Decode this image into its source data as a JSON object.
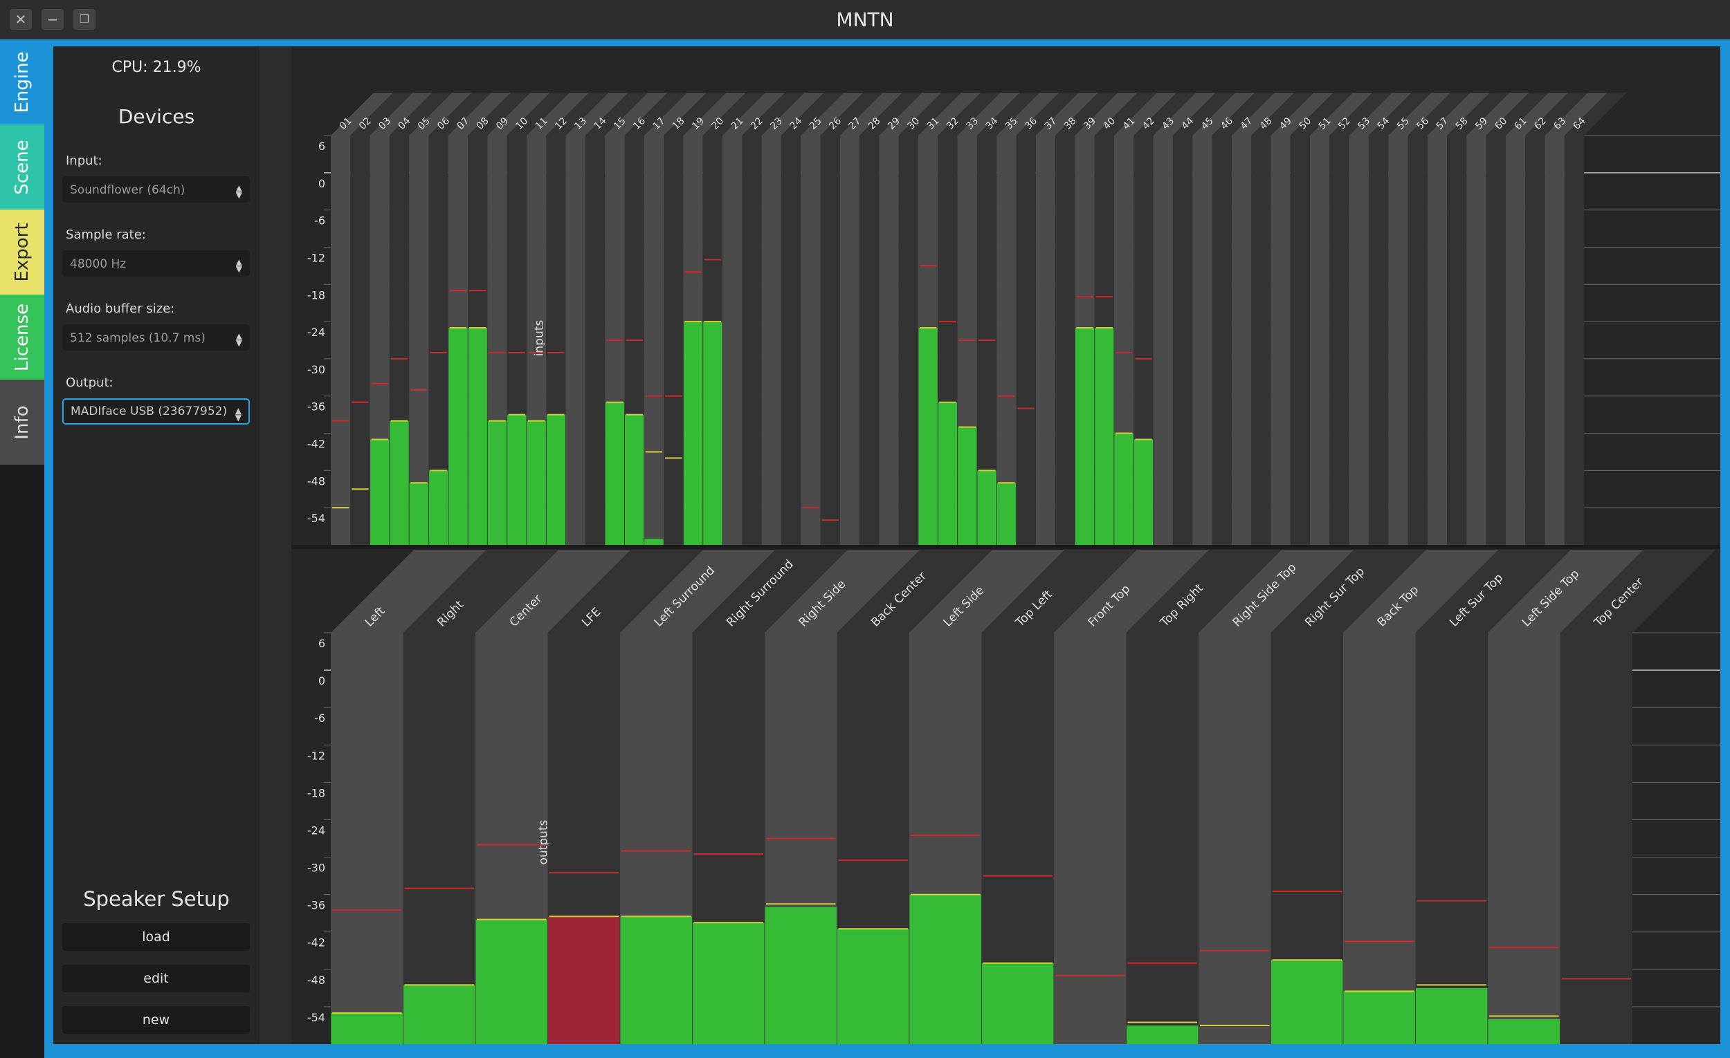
{
  "window": {
    "title": "MNTN"
  },
  "tabs": [
    {
      "label": "Engine",
      "color": "#1c93d6"
    },
    {
      "label": "Scene",
      "color": "#2ec4a9"
    },
    {
      "label": "Export",
      "color": "#e8e26a"
    },
    {
      "label": "License",
      "color": "#35c45a"
    },
    {
      "label": "Info",
      "color": "#4a4a4a"
    }
  ],
  "cpu": {
    "text": "CPU:  21.9%"
  },
  "devices": {
    "title": "Devices",
    "input_label": "Input:",
    "input_value": "Soundflower (64ch)",
    "samplerate_label": "Sample rate:",
    "samplerate_value": "48000 Hz",
    "buffer_label": "Audio buffer size:",
    "buffer_value": "512 samples (10.7 ms)",
    "output_label": "Output:",
    "output_value": "MADIface USB (23677952)"
  },
  "speaker_setup": {
    "title": "Speaker Setup",
    "load": "load",
    "edit": "edit",
    "new": "new"
  },
  "colors": {
    "meter_green": "#35bb35",
    "clip_red": "#9e2438",
    "peak_red": "#d02a2a",
    "peak_yellow": "#d8cf3a",
    "accent": "#1c93d6"
  },
  "chart_data": [
    {
      "type": "bar",
      "ylabel": "inputs",
      "ylim": [
        -60,
        6
      ],
      "yticks": [
        6,
        0,
        -6,
        -12,
        -18,
        -24,
        -30,
        -36,
        -42,
        -48,
        -54
      ],
      "categories": [
        "01",
        "02",
        "03",
        "04",
        "05",
        "06",
        "07",
        "08",
        "09",
        "10",
        "11",
        "12",
        "13",
        "14",
        "15",
        "16",
        "17",
        "18",
        "19",
        "20",
        "21",
        "22",
        "23",
        "24",
        "25",
        "26",
        "27",
        "28",
        "29",
        "30",
        "31",
        "32",
        "33",
        "34",
        "35",
        "36",
        "37",
        "38",
        "39",
        "40",
        "41",
        "42",
        "43",
        "44",
        "45",
        "46",
        "47",
        "48",
        "49",
        "50",
        "51",
        "52",
        "53",
        "54",
        "55",
        "56",
        "57",
        "58",
        "59",
        "60",
        "61",
        "62",
        "63",
        "64"
      ],
      "values": [
        -60,
        -60,
        -43,
        -40,
        -50,
        -48,
        -25,
        -25,
        -40,
        -39,
        -40,
        -39,
        -60,
        -60,
        -37,
        -39,
        -59,
        -60,
        -24,
        -24,
        -60,
        -60,
        -60,
        -60,
        -60,
        -60,
        -60,
        -60,
        -60,
        -60,
        -25,
        -37,
        -41,
        -48,
        -50,
        -60,
        -60,
        -60,
        -25,
        -25,
        -42,
        -43,
        -60,
        -60,
        -60,
        -60,
        -60,
        -60,
        -60,
        -60,
        -60,
        -60,
        -60,
        -60,
        -60,
        -60,
        -60,
        -60,
        -60,
        -60,
        -60,
        -60,
        -60,
        -60
      ],
      "peaks": [
        -54,
        -51,
        -43,
        -40,
        -50,
        -48,
        -25,
        -25,
        -40,
        -39,
        -40,
        -39,
        null,
        null,
        -37,
        -39,
        -45,
        -46,
        -24,
        -24,
        null,
        null,
        null,
        null,
        null,
        null,
        null,
        null,
        null,
        null,
        -25,
        -37,
        -41,
        -48,
        -50,
        null,
        null,
        null,
        -25,
        -25,
        -42,
        -43,
        null,
        null,
        null,
        null,
        null,
        null,
        null,
        null,
        null,
        null,
        null,
        null,
        null,
        null,
        null,
        null,
        null,
        null,
        null,
        null,
        null,
        null
      ],
      "holds": [
        -40,
        -37,
        -34,
        -30,
        -35,
        -29,
        -19,
        -19,
        -29,
        -29,
        -29,
        -29,
        null,
        null,
        -27,
        -27,
        -36,
        -36,
        -16,
        -14,
        null,
        null,
        null,
        null,
        -54,
        -56,
        null,
        null,
        null,
        null,
        -15,
        -24,
        -27,
        -27,
        -36,
        -38,
        null,
        null,
        -20,
        -20,
        -29,
        -30,
        null,
        null,
        null,
        null,
        null,
        null,
        null,
        null,
        null,
        null,
        null,
        null,
        null,
        null,
        null,
        null,
        null,
        null,
        null,
        null,
        null,
        null
      ]
    },
    {
      "type": "bar",
      "ylabel": "outputs",
      "ylim": [
        -60,
        6
      ],
      "yticks": [
        6,
        0,
        -6,
        -12,
        -18,
        -24,
        -30,
        -36,
        -42,
        -48,
        -54
      ],
      "categories": [
        "Left",
        "Right",
        "Center",
        "LFE",
        "Left Surround",
        "Right Surround",
        "Right Side",
        "Back Center",
        "Left Side",
        "Top Left",
        "Front Top",
        "Top Right",
        "Right Side Top",
        "Right Sur Top",
        "Back Top",
        "Left Sur Top",
        "Left Side Top",
        "Top Center"
      ],
      "values": [
        -55,
        -50.5,
        -40,
        -39.5,
        -39.5,
        -40.5,
        -38,
        -41.5,
        -36,
        -47,
        -60,
        -57,
        -60,
        -46.5,
        -51.5,
        -51,
        -56,
        -60
      ],
      "peaks": [
        -55,
        -50.5,
        -40,
        -39.5,
        -39.5,
        -40.5,
        -37.5,
        -41.5,
        -36,
        -47,
        null,
        -56.5,
        -57,
        -46.5,
        -51.5,
        -50.5,
        -55.5,
        null
      ],
      "holds": [
        -38.5,
        -35,
        -28,
        -32.5,
        -29,
        -29.5,
        -27,
        -30.5,
        -26.5,
        -33,
        -49,
        -47,
        -45,
        -35.5,
        -43.5,
        -37,
        -44.5,
        -49.5
      ],
      "clipped": [
        false,
        false,
        false,
        true,
        false,
        false,
        false,
        false,
        false,
        false,
        false,
        false,
        false,
        false,
        false,
        false,
        false,
        false
      ]
    }
  ]
}
